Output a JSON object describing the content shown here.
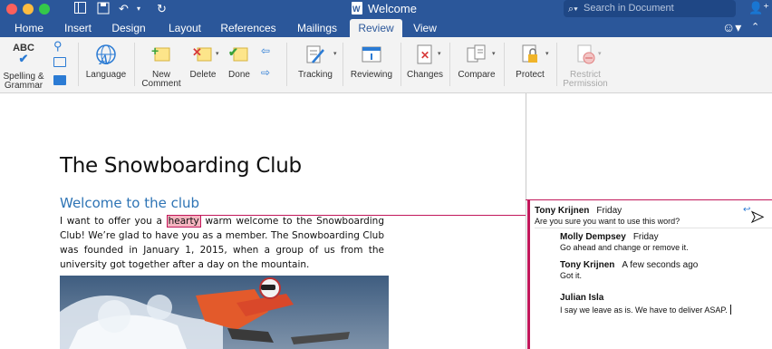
{
  "window": {
    "title": "Welcome"
  },
  "search": {
    "placeholder": "Search in Document"
  },
  "tabs": [
    {
      "label": "Home"
    },
    {
      "label": "Insert"
    },
    {
      "label": "Design"
    },
    {
      "label": "Layout"
    },
    {
      "label": "References"
    },
    {
      "label": "Mailings"
    },
    {
      "label": "Review"
    },
    {
      "label": "View"
    }
  ],
  "active_tab": "Review",
  "ribbon": {
    "spelling": "Spelling &\nGrammar",
    "spelling_l1": "Spelling &",
    "spelling_l2": "Grammar",
    "abc_label": "ABC",
    "language": "Language",
    "new_comment_l1": "New",
    "new_comment_l2": "Comment",
    "delete": "Delete",
    "done": "Done",
    "tracking": "Tracking",
    "reviewing": "Reviewing",
    "changes": "Changes",
    "compare": "Compare",
    "protect": "Protect",
    "restrict_l1": "Restrict",
    "restrict_l2": "Permission"
  },
  "document": {
    "title": "The Snowboarding Club",
    "heading": "Welcome to the club",
    "para_before": "I want to offer you a ",
    "highlight": "hearty",
    "para_after": " warm welcome to the Snowboarding Club! We’re glad to have you as a member. The Snowboarding Club was founded in January 1, 2015, when a group of us from the university got together after a day on the mountain."
  },
  "comments": [
    {
      "author": "Tony Krijnen",
      "time": "Friday",
      "text": "Are you sure you want to use this word?"
    },
    {
      "author": "Molly Dempsey",
      "time": "Friday",
      "text": "Go ahead and change or remove it."
    },
    {
      "author": "Tony Krijnen",
      "time": "A few seconds ago",
      "text": "Got it."
    },
    {
      "author": "Julian Isla",
      "time": "",
      "text": "I say we leave as is. We have to deliver ASAP."
    }
  ],
  "colors": {
    "brand": "#2b579a",
    "comment_accent": "#c2185b",
    "heading_blue": "#2e74b5"
  }
}
